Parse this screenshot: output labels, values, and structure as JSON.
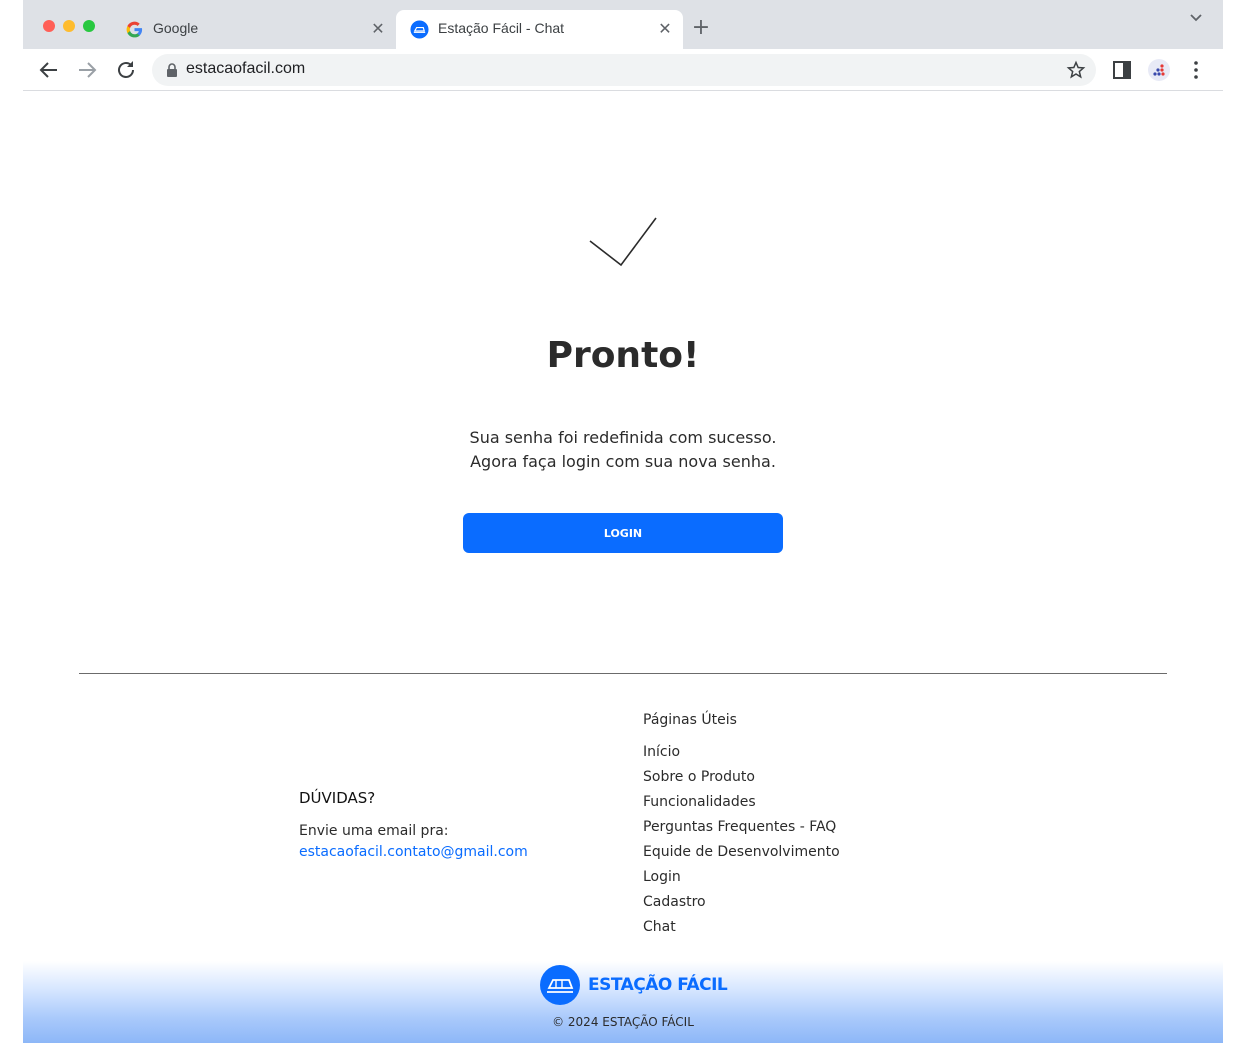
{
  "browser": {
    "tabs": [
      {
        "title": "Google",
        "favicon": "google-g-icon",
        "active": false
      },
      {
        "title": "Estação Fácil - Chat",
        "favicon": "estacao-facil-icon",
        "active": true
      }
    ],
    "close_glyph": "✕",
    "new_tab_glyph": "+",
    "url": "estacaofacil.com"
  },
  "main": {
    "icon": "checkmark-icon",
    "title": "Pronto!",
    "message_line1": "Sua senha foi redefinida com sucesso.",
    "message_line2": "Agora faça login com sua nova senha.",
    "login_button": "LOGIN"
  },
  "footer": {
    "contact": {
      "heading": "DÚVIDAS?",
      "text": "Envie uma email pra:",
      "email": "estacaofacil.contato@gmail.com"
    },
    "links_heading": "Páginas Úteis",
    "links": [
      "Início",
      "Sobre o Produto",
      "Funcionalidades",
      "Perguntas Frequentes - FAQ",
      "Equide de Desenvolvimento",
      "Login",
      "Cadastro",
      "Chat"
    ],
    "brand_name": "ESTAÇÃO FÁCIL",
    "copyright": "© 2024 ESTAÇÃO FÁCIL"
  },
  "colors": {
    "accent": "#0a6cff",
    "tab_strip": "#dee1e6",
    "text": "#2b2b2b"
  }
}
